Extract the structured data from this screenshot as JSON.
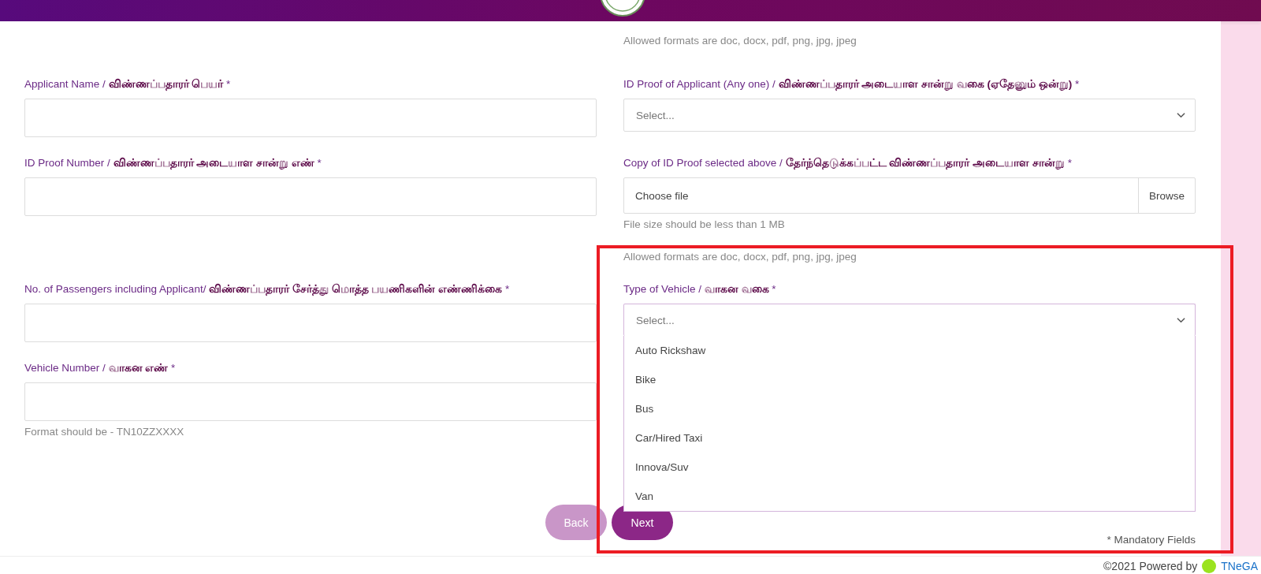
{
  "top_note": "Allowed formats are doc, docx, pdf, png, jpg, jpeg",
  "rows": [
    {
      "cells": [
        {
          "kind": "text",
          "label": "Applicant Name / **விண்ணப்பதாரர் பெயர்** *"
        },
        {
          "kind": "select",
          "label": "ID Proof of Applicant (Any one) / **விண்ணப்பதாரர் அடையாள சான்று வகை (ஏதேனும் ஒன்று)** *",
          "placeholder": "Select...",
          "expanded": false
        }
      ]
    },
    {
      "cells": [
        {
          "kind": "text",
          "label": "ID Proof Number / **விண்ணப்பதாரர் அடையாள சான்று எண்** *"
        },
        {
          "kind": "file",
          "label": "Copy of ID Proof selected above / **தேர்ந்தெடுக்கப்பட்ட விண்ணப்பதாரர் அடையாள சான்று** *",
          "placeholder": "Choose file",
          "button": "Browse",
          "hints": [
            "File size should be less than 1 MB",
            "Allowed formats are doc, docx, pdf, png, jpg, jpeg"
          ]
        }
      ]
    },
    {
      "cells": [
        {
          "kind": "text",
          "label": "No. of Passengers including Applicant/ **விண்ணப்பதாரர் சேர்த்து மொத்த பயணிகளின் எண்ணிக்கை** *"
        },
        {
          "kind": "select",
          "label": "Type of Vehicle / **வாகன வகை** *",
          "placeholder": "Select...",
          "expanded": true,
          "options": [
            {
              "label": "Auto Rickshaw",
              "selected": false
            },
            {
              "label": "Bike",
              "selected": false
            },
            {
              "label": "Bus",
              "selected": false
            },
            {
              "label": "Car/Hired Taxi",
              "selected": false
            },
            {
              "label": "Innova/Suv",
              "selected": false
            },
            {
              "label": "Van",
              "selected": false
            }
          ]
        }
      ]
    },
    {
      "cells": [
        {
          "kind": "text",
          "label": "Vehicle Number / **வாகன எண்** *",
          "hints": [
            "Format should be - TN10ZZXXXX"
          ]
        }
      ]
    }
  ],
  "buttons": [
    {
      "label": "Back",
      "kind": "secondary"
    },
    {
      "label": "Next",
      "kind": "primary"
    }
  ],
  "mandatory_note": "* Mandatory Fields",
  "footer": {
    "text": "©2021 Powered by",
    "brand": "TNeGA"
  }
}
